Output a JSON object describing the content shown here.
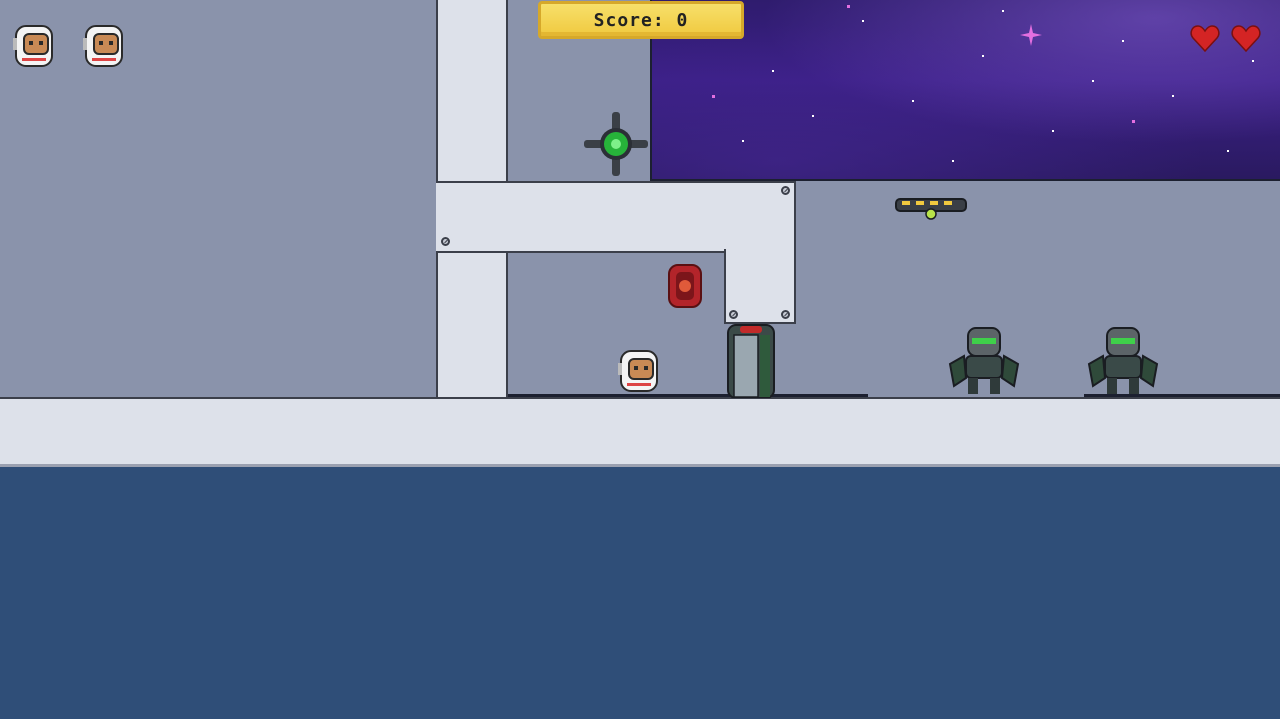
{
  "hud": {
    "score_label": "Score:",
    "score_value": "0",
    "lives_icons": [
      "astronaut-life-icon",
      "astronaut-life-icon"
    ],
    "health_icons": [
      "heart-icon",
      "heart-icon"
    ]
  },
  "colors": {
    "wall": "#8a93ab",
    "pipe": "#dde1ea",
    "space": "#3b1f86",
    "deep_floor": "#2f4e78",
    "score_bg": "#f0c93f",
    "heart": "#d42424",
    "enemy_eyes": "#3fd04a"
  },
  "sprites": {
    "player": "astronaut-player",
    "enemies": [
      "alien-robot-enemy",
      "alien-robot-enemy"
    ],
    "items": [
      "green-orb-drone",
      "red-fuel-canister",
      "hover-platform",
      "sliding-door"
    ]
  }
}
